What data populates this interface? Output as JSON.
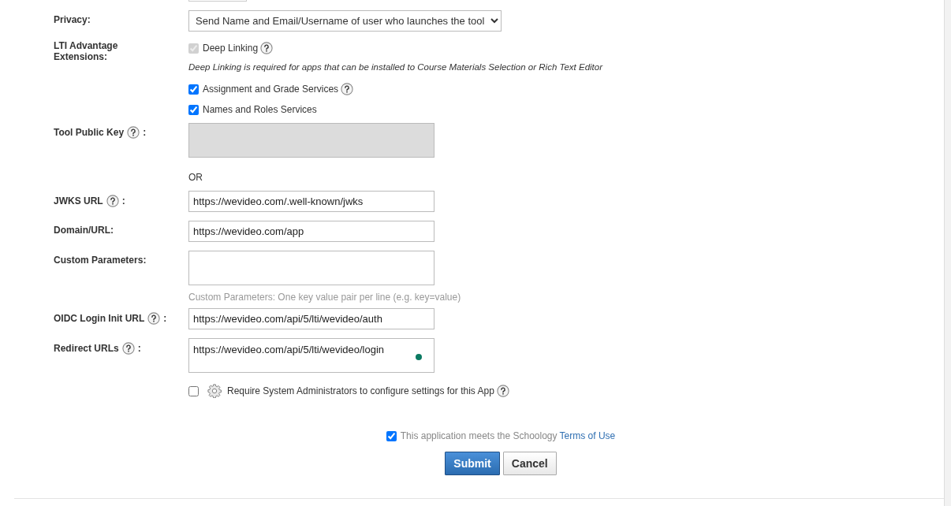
{
  "privacy": {
    "label": "Privacy:",
    "value": "Send Name and Email/Username of user who launches the tool"
  },
  "lti_extensions": {
    "label": "LTI Advantage Extensions:",
    "items": [
      {
        "kind": "checkbox",
        "label": "Deep Linking",
        "checked": true,
        "disabled": true,
        "help": true
      },
      {
        "kind": "note",
        "text": "Deep Linking is required for apps that can be installed to Course Materials Selection or Rich Text Editor"
      },
      {
        "kind": "checkbox",
        "label": "Assignment and Grade Services",
        "checked": true,
        "disabled": false,
        "help": true
      },
      {
        "kind": "checkbox",
        "label": "Names and Roles Services",
        "checked": true,
        "disabled": false,
        "help": false
      }
    ]
  },
  "tool_public_key": {
    "label": "Tool Public Key",
    "help": true,
    "suffix": ":",
    "disabled": true
  },
  "or_text": "OR",
  "url_fields": [
    {
      "kind": "input",
      "label": "JWKS URL",
      "help": true,
      "suffix": ":",
      "value": "https://wevideo.com/.well-known/jwks"
    },
    {
      "kind": "input",
      "label": "Domain/URL:",
      "help": false,
      "value": "https://wevideo.com/app"
    },
    {
      "kind": "textarea",
      "label": "Custom Parameters:",
      "help": false,
      "hint": "Custom Parameters: One key value pair per line (e.g. key=value)"
    },
    {
      "kind": "input",
      "label": "OIDC Login Init URL",
      "help": true,
      "suffix": ":",
      "value": "https://wevideo.com/api/5/lti/wevideo/auth"
    },
    {
      "kind": "textarea",
      "label": "Redirect URLs",
      "help": true,
      "suffix": ":",
      "value": "https://wevideo.com/api/5/lti/wevideo/login",
      "indicator": true
    }
  ],
  "admin_option": {
    "label": "Require System Administrators to configure settings for this App",
    "checked": false,
    "help": true
  },
  "terms": {
    "text": "This application meets the Schoology",
    "link": "Terms of Use",
    "checked": true
  },
  "buttons": [
    {
      "label": "Submit",
      "kind": "primary"
    },
    {
      "label": "Cancel",
      "kind": "secondary"
    }
  ]
}
